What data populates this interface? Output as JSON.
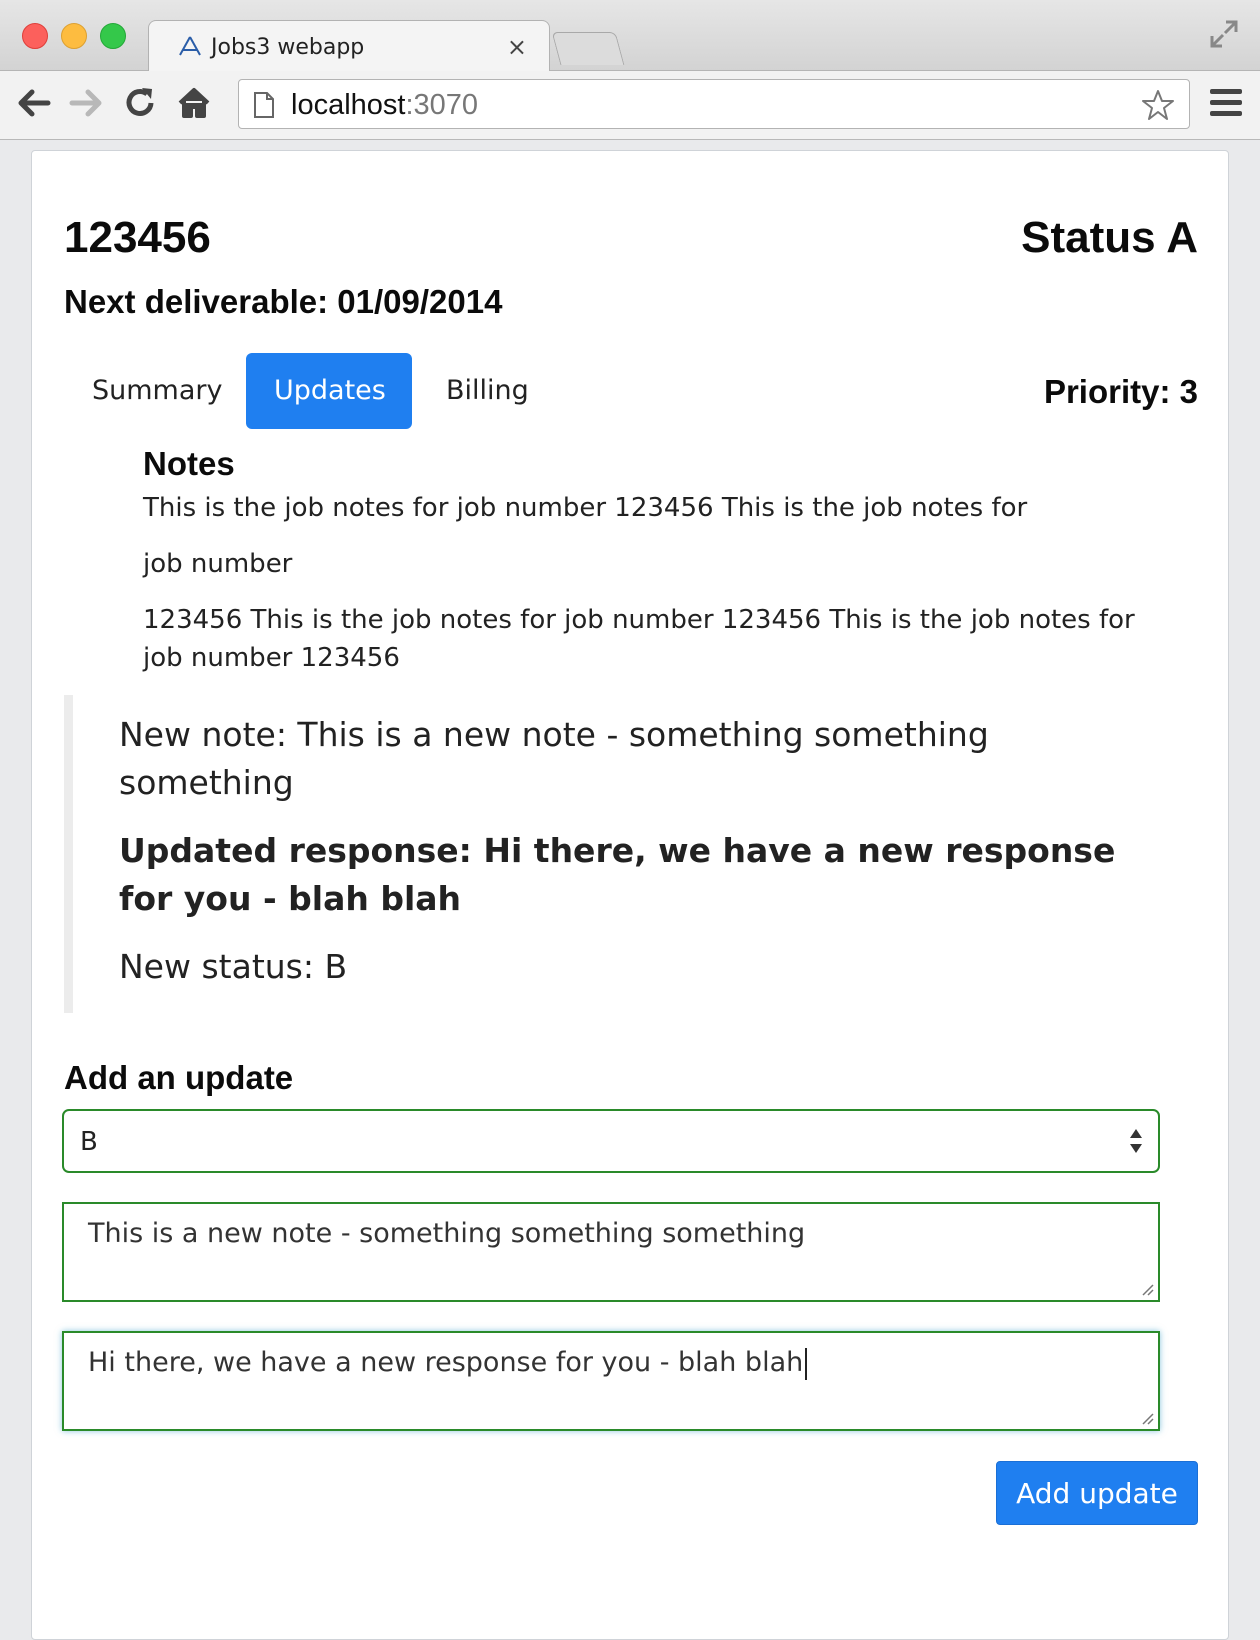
{
  "browser": {
    "tab_title": "Jobs3 webapp",
    "tab_close": "×",
    "url_host": "localhost",
    "url_port": ":3070"
  },
  "job": {
    "number": "123456",
    "status": "Status A",
    "next_deliverable": "Next deliverable: 01/09/2014",
    "priority": "Priority: 3"
  },
  "tabs": [
    {
      "label": "Summary",
      "active": false
    },
    {
      "label": "Updates",
      "active": true
    },
    {
      "label": "Billing",
      "active": false
    }
  ],
  "notes": {
    "heading": "Notes",
    "lines": [
      "This is the job notes for job number 123456 This is the job notes for",
      "job number",
      "123456 This is the job notes for job number 123456 This is the job notes for job number 123456"
    ]
  },
  "update": {
    "new_note": "New note: This is a new note - something something something",
    "updated_response": "Updated response: Hi there, we have a new response for you - blah blah",
    "new_status": "New status: B"
  },
  "form": {
    "heading": "Add an update",
    "status_selected": "B",
    "note_value": "This is a new note - something something something",
    "response_value": "Hi there, we have a new response for you - blah blah",
    "submit_label": "Add update"
  },
  "colors": {
    "accent": "#1f7ff0",
    "valid_border": "#2a8a2a"
  }
}
